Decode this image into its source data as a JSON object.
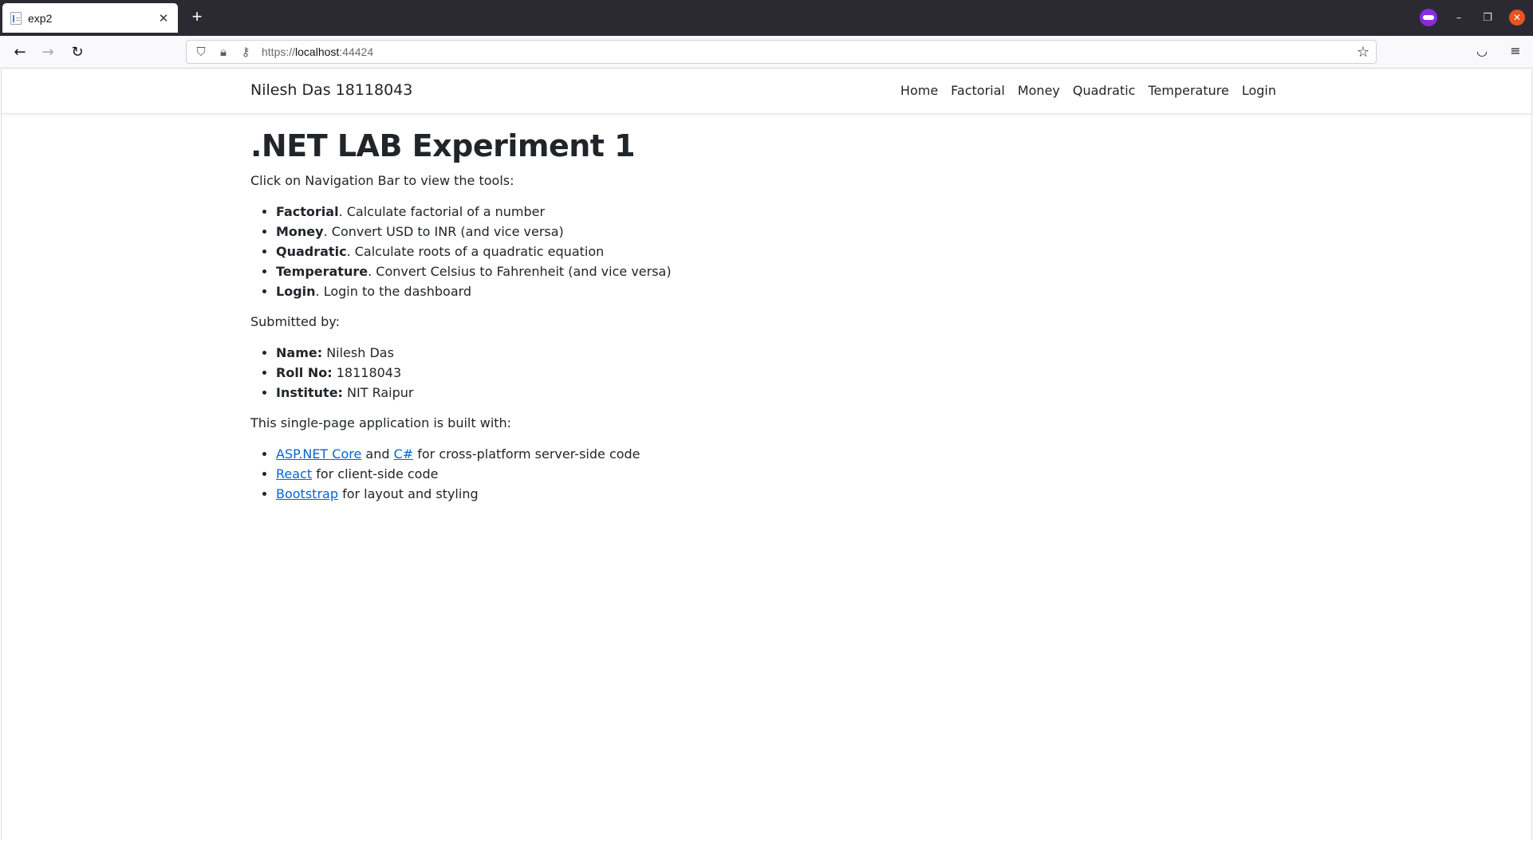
{
  "browser": {
    "tab_title": "exp2",
    "new_tab": "+",
    "url_scheme": "https://",
    "url_host": "localhost",
    "url_port": ":44424"
  },
  "site": {
    "brand": "Nilesh Das 18118043",
    "menu": [
      "Home",
      "Factorial",
      "Money",
      "Quadratic",
      "Temperature",
      "Login"
    ]
  },
  "main": {
    "heading": ".NET LAB Experiment 1",
    "intro": "Click on Navigation Bar to view the tools:",
    "tools": [
      {
        "name": "Factorial",
        "desc": ". Calculate factorial of a number"
      },
      {
        "name": "Money",
        "desc": ". Convert USD to INR (and vice versa)"
      },
      {
        "name": "Quadratic",
        "desc": ". Calculate roots of a quadratic equation"
      },
      {
        "name": "Temperature",
        "desc": ". Convert Celsius to Fahrenheit (and vice versa)"
      },
      {
        "name": "Login",
        "desc": ". Login to the dashboard"
      }
    ],
    "submitted_label": "Submitted by:",
    "submitter": [
      {
        "label": "Name:",
        "value": " Nilesh Das"
      },
      {
        "label": "Roll No:",
        "value": " 18118043"
      },
      {
        "label": "Institute:",
        "value": " NIT Raipur"
      }
    ],
    "built_label": "This single-page application is built with:",
    "built": {
      "line1_link1": "ASP.NET Core",
      "line1_and": " and ",
      "line1_link2": "C#",
      "line1_rest": " for cross-platform server-side code",
      "line2_link": "React",
      "line2_rest": " for client-side code",
      "line3_link": "Bootstrap",
      "line3_rest": " for layout and styling"
    }
  },
  "colors": {
    "link": "#0366d6",
    "tabbar": "#2b2a33",
    "private_badge": "#8a2be2",
    "close": "#e95420"
  }
}
